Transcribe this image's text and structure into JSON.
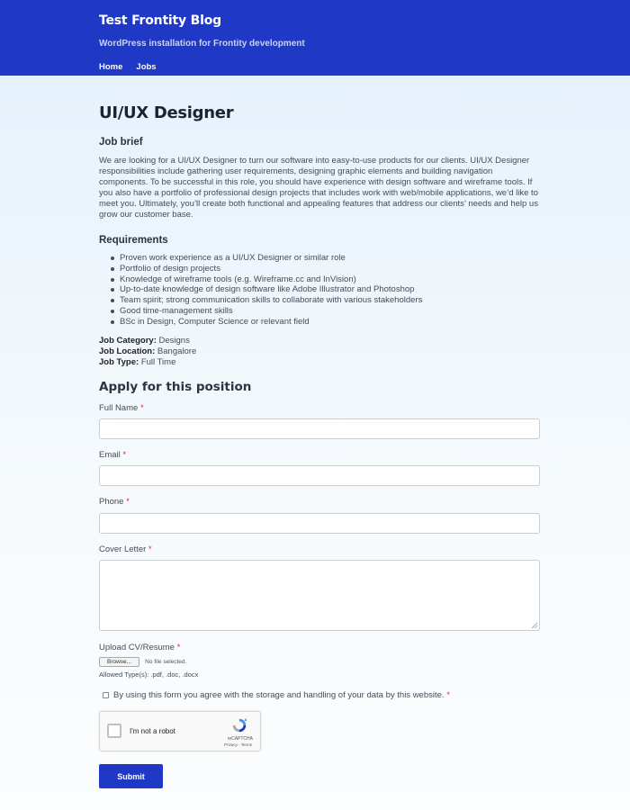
{
  "site": {
    "title": "Test Frontity Blog",
    "description": "WordPress installation for Frontity development",
    "nav": [
      "Home",
      "Jobs"
    ],
    "header_color": "#1f38c5"
  },
  "job": {
    "title": "UI/UX Designer",
    "brief_heading": "Job brief",
    "brief": "We are looking for a UI/UX Designer to turn our software into easy-to-use products for our clients. UI/UX Designer responsibilities include gathering user requirements, designing graphic elements and building navigation components. To be successful in this role, you should have experience with design software and wireframe tools. If you also have a portfolio of professional design projects that includes work with web/mobile applications, we’d like to meet you. Ultimately, you’ll create both functional and appealing features that address our clients’ needs and help us grow our customer base.",
    "requirements_heading": "Requirements",
    "requirements": [
      "Proven work experience as a UI/UX Designer or similar role",
      "Portfolio of design projects",
      "Knowledge of wireframe tools (e.g. Wireframe.cc and InVision)",
      "Up-to-date knowledge of design software like Adobe Illustrator and Photoshop",
      "Team spirit; strong communication skills to collaborate with various stakeholders",
      "Good time-management skills",
      "BSc in Design, Computer Science or relevant field"
    ],
    "meta": {
      "category_label": "Job Category:",
      "category": "Designs",
      "location_label": "Job Location:",
      "location": "Bangalore",
      "type_label": "Job Type:",
      "type": "Full Time"
    }
  },
  "form": {
    "heading": "Apply for this position",
    "required_mark": "*",
    "full_name_label": "Full Name",
    "full_name_value": "",
    "email_label": "Email",
    "email_value": "",
    "phone_label": "Phone",
    "phone_value": "",
    "cover_letter_label": "Cover Letter",
    "cover_letter_value": "",
    "upload_label": "Upload CV/Resume",
    "browse_label": "Browse...",
    "no_file_text": "No file selected.",
    "allowed_types": "Allowed Type(s): .pdf, .doc, .docx",
    "consent_text": "By using this form you agree with the storage and handling of your data by this website.",
    "recaptcha_label": "I'm not a robot",
    "recaptcha_brand": "reCAPTCHA",
    "recaptcha_links": "Privacy - Terms",
    "submit_label": "Submit"
  }
}
